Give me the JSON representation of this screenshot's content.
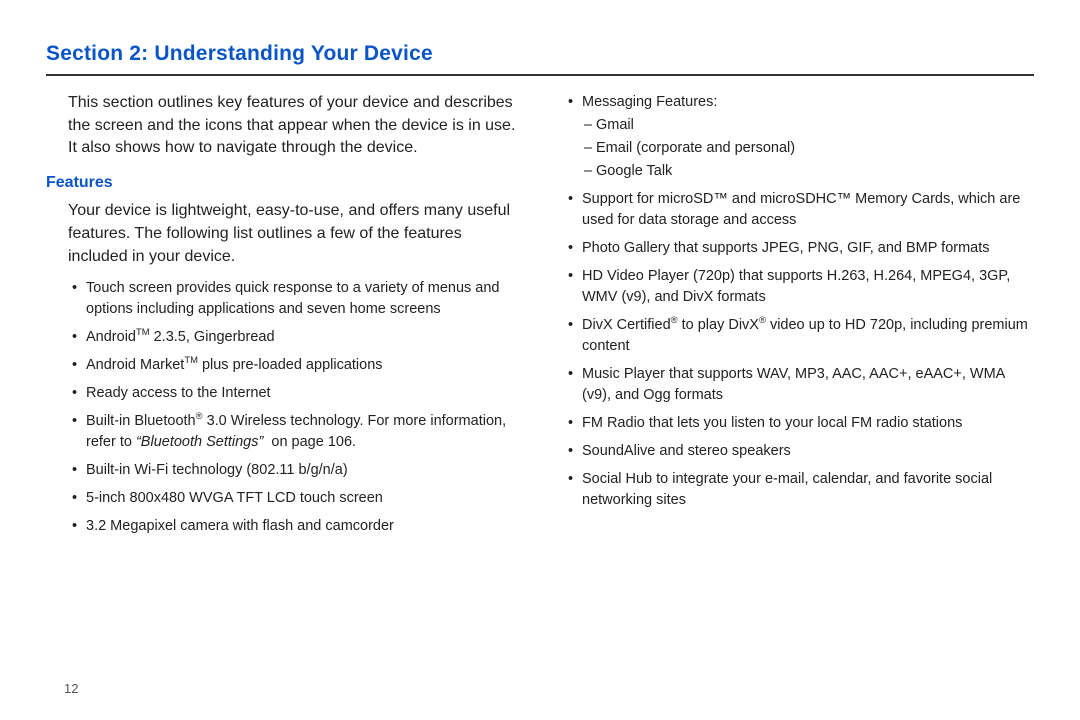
{
  "page": {
    "number": "12",
    "title": "Section 2: Understanding Your Device",
    "intro": "This section outlines key features of your device and describes the screen and the icons that appear when the device is in use. It also shows how to navigate through the device.",
    "subhead": "Features",
    "subintro": "Your device is lightweight, easy-to-use, and offers many useful features. The following list outlines a few of the features included in your device.",
    "left_bullets": [
      {
        "html": "Touch screen provides quick response to a variety of menus and options including applications and seven home screens"
      },
      {
        "html": "Android<sup>TM</sup> 2.3.5, Gingerbread"
      },
      {
        "html": "Android Market<sup>TM</sup> plus pre-loaded applications"
      },
      {
        "html": "Ready access to the Internet"
      },
      {
        "html": "Built-in Bluetooth<sup>®</sup> 3.0 Wireless technology. For more information, refer to <span class=\"ref-italic\">&ldquo;Bluetooth Settings&rdquo;</span>&nbsp; on page 106."
      },
      {
        "html": "Built-in Wi-Fi technology (802.11 b/g/n/a)"
      },
      {
        "html": "5-inch 800x480 WVGA TFT LCD touch screen"
      },
      {
        "html": "3.2 Megapixel camera with flash and camcorder"
      }
    ],
    "right_bullets": [
      {
        "html": "Messaging Features:",
        "sub": [
          "Gmail",
          "Email (corporate and personal)",
          "Google Talk"
        ]
      },
      {
        "html": "Support for microSD™ and microSDHC™ Memory Cards, which are used for data storage and access"
      },
      {
        "html": "Photo Gallery that supports JPEG, PNG, GIF, and BMP formats"
      },
      {
        "html": "HD Video Player (720p) that supports H.263, H.264, MPEG4, 3GP, WMV (v9), and DivX formats"
      },
      {
        "html": "DivX Certified<sup>®</sup> to play DivX<sup>®</sup> video up to HD 720p, including premium content"
      },
      {
        "html": "Music Player that supports WAV, MP3, AAC, AAC+, eAAC+, WMA (v9), and Ogg formats"
      },
      {
        "html": "FM Radio that lets you listen to your local FM radio stations"
      },
      {
        "html": "SoundAlive and stereo speakers"
      },
      {
        "html": "Social Hub to integrate your e-mail, calendar, and favorite social networking sites"
      }
    ]
  }
}
